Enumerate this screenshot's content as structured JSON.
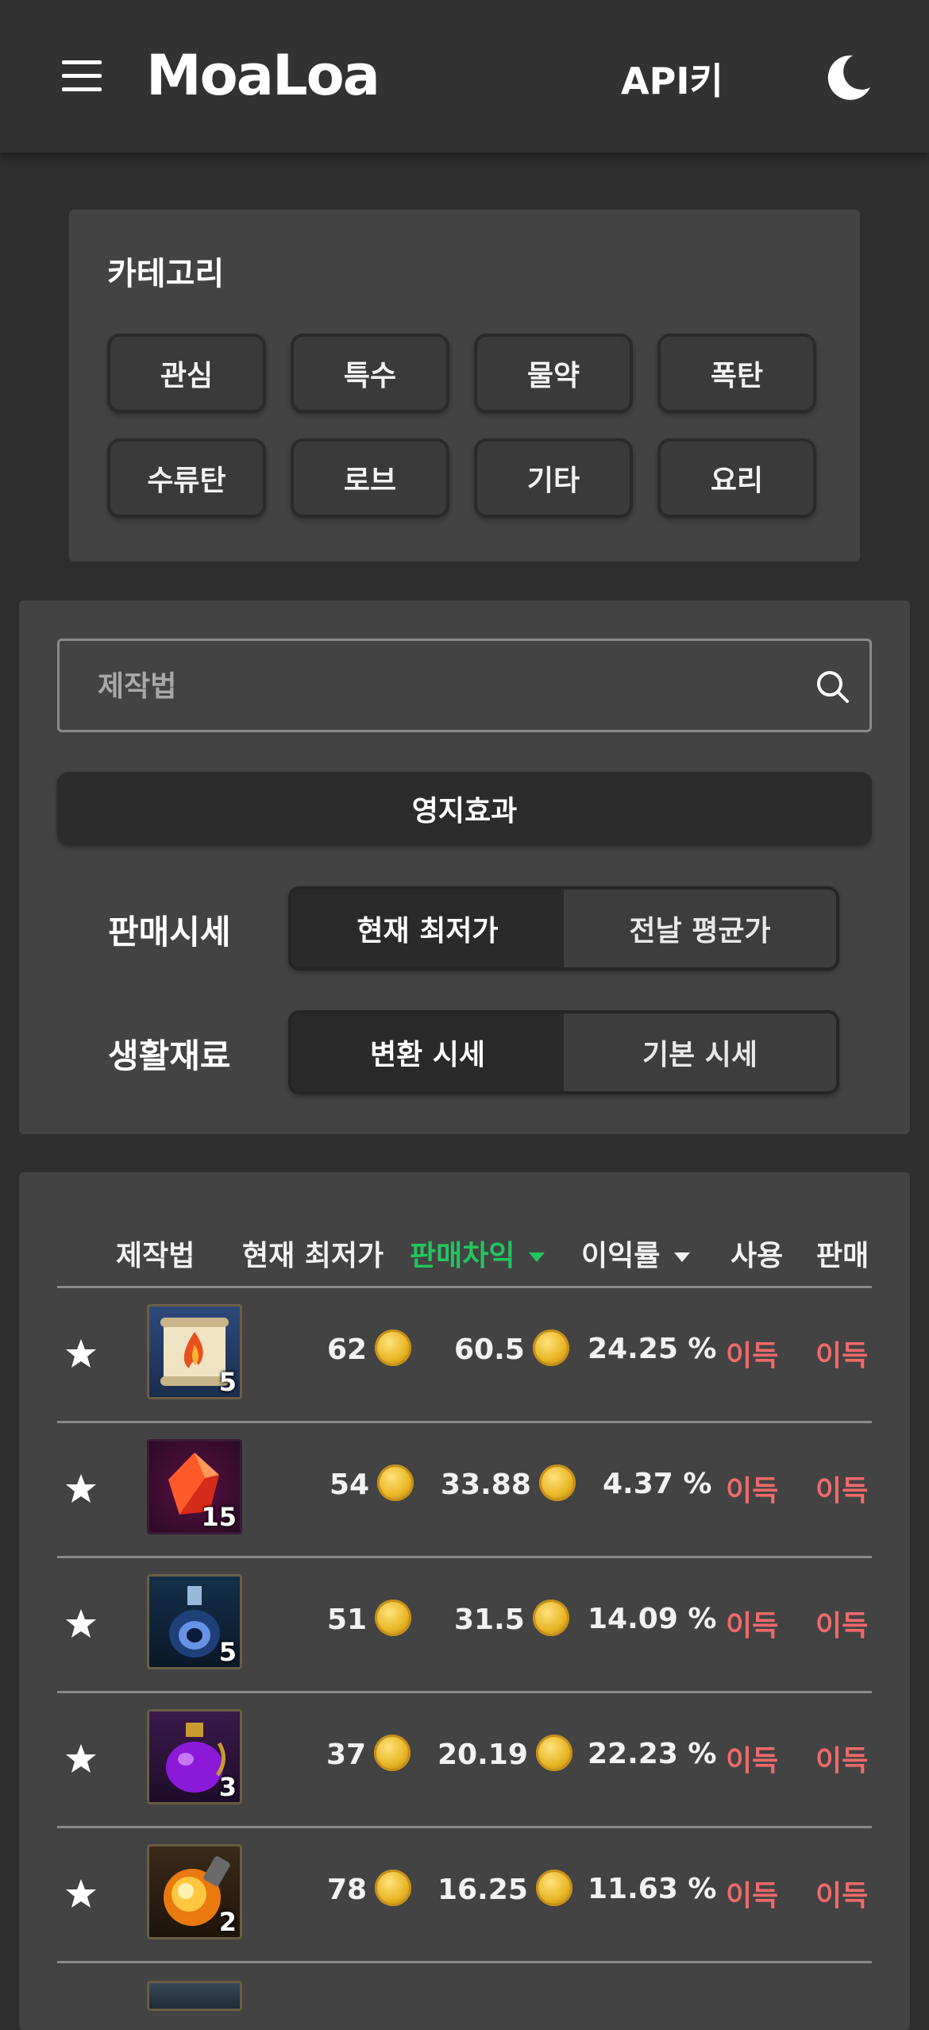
{
  "header": {
    "logo": "MoaLoa",
    "api_key_label": "API키"
  },
  "category": {
    "title": "카테고리",
    "buttons": [
      "관심",
      "특수",
      "물약",
      "폭탄",
      "수류탄",
      "로브",
      "기타",
      "요리"
    ]
  },
  "filters": {
    "search_placeholder": "제작법",
    "territory_label": "영지효과",
    "price_label": "판매시세",
    "price_options": [
      "현재 최저가",
      "전날 평균가"
    ],
    "material_label": "생활재료",
    "material_options": [
      "변환 시세",
      "기본 시세"
    ]
  },
  "table": {
    "headers": [
      "제작법",
      "현재 최저가",
      "판매차익",
      "이익률",
      "사용",
      "판매"
    ],
    "rows": [
      {
        "qty": "5",
        "price": "62",
        "margin": "60.5",
        "rate": "24.25 %",
        "use": "이득",
        "sell": "이득",
        "icon": "fire-scroll-icon"
      },
      {
        "qty": "15",
        "price": "54",
        "margin": "33.88",
        "rate": "4.37 %",
        "use": "이득",
        "sell": "이득",
        "icon": "red-crystal-icon"
      },
      {
        "qty": "5",
        "price": "51",
        "margin": "31.5",
        "rate": "14.09 %",
        "use": "이득",
        "sell": "이득",
        "icon": "blue-flask-icon"
      },
      {
        "qty": "3",
        "price": "37",
        "margin": "20.19",
        "rate": "22.23 %",
        "use": "이득",
        "sell": "이득",
        "icon": "purple-potion-icon"
      },
      {
        "qty": "2",
        "price": "78",
        "margin": "16.25",
        "rate": "11.63 %",
        "use": "이득",
        "sell": "이득",
        "icon": "fire-bomb-icon"
      }
    ]
  },
  "colors": {
    "accent_sort": "#22c55e",
    "profit": "#f06a6a",
    "background": "#2e2e2e",
    "card": "#434343"
  }
}
